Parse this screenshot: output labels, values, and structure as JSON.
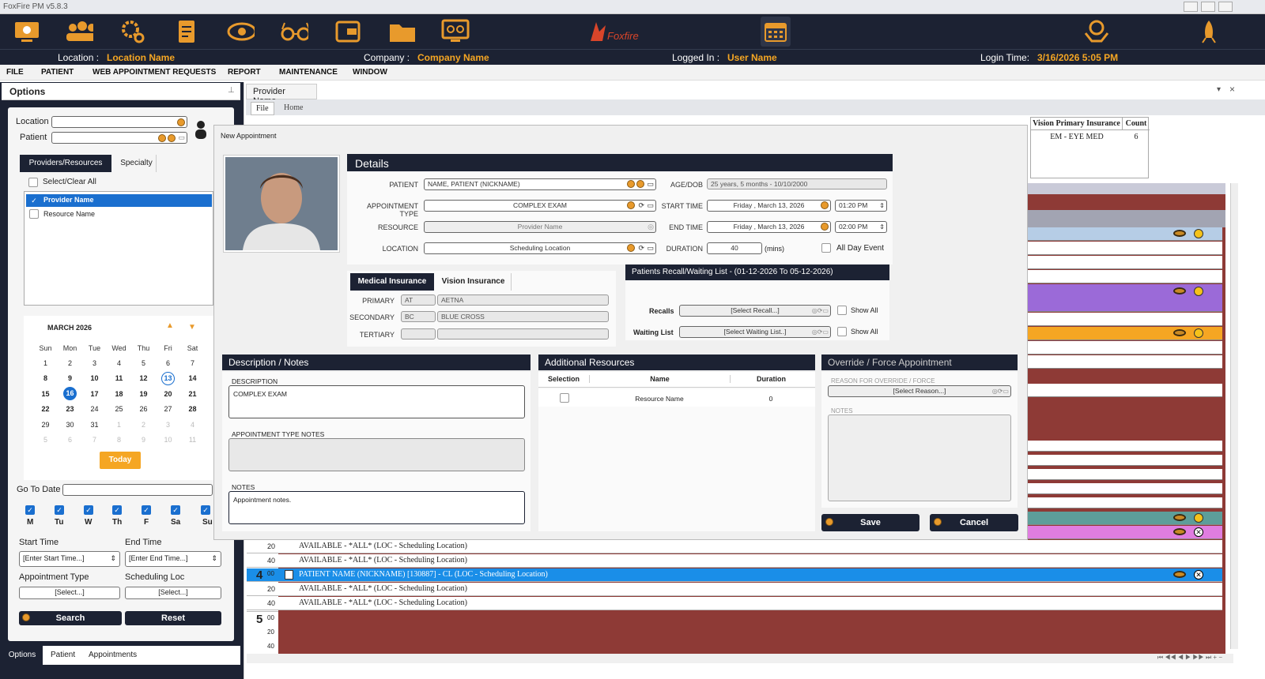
{
  "window": {
    "title": "FoxFire PM v5.8.3"
  },
  "toolbar": {
    "logo_text": "Foxfire"
  },
  "info": {
    "location_label": "Location :",
    "location_value": "Location Name",
    "company_label": "Company :",
    "company_value": "Company Name",
    "logged_label": "Logged In :",
    "logged_value": "User Name",
    "login_label": "Login Time:",
    "login_value": "3/16/2026 5:05 PM"
  },
  "menu": [
    "FILE",
    "PATIENT",
    "WEB APPOINTMENT REQUESTS",
    "REPORT",
    "MAINTENANCE",
    "WINDOW"
  ],
  "options": {
    "title": "Options",
    "location_label": "Location",
    "patient_label": "Patient",
    "tabs": [
      "Providers/Resources",
      "Specialty"
    ],
    "select_all": "Select/Clear All",
    "resources": [
      "Provider Name",
      "Resource Name"
    ],
    "calendar": {
      "month": "MARCH 2026",
      "days": [
        "Sun",
        "Mon",
        "Tue",
        "Wed",
        "Thu",
        "Fri",
        "Sat"
      ],
      "weeks": [
        [
          "1",
          "2",
          "3",
          "4",
          "5",
          "6",
          "7"
        ],
        [
          "8",
          "9",
          "10",
          "11",
          "12",
          "13",
          "14"
        ],
        [
          "15",
          "16",
          "17",
          "18",
          "19",
          "20",
          "21"
        ],
        [
          "22",
          "23",
          "24",
          "25",
          "26",
          "27",
          "28"
        ],
        [
          "29",
          "30",
          "31",
          "1",
          "2",
          "3",
          "4"
        ],
        [
          "5",
          "6",
          "7",
          "8",
          "9",
          "10",
          "11"
        ]
      ]
    },
    "today_button": "Today",
    "goto_label": "Go To Date",
    "weekdays": [
      "M",
      "Tu",
      "W",
      "Th",
      "F",
      "Sa",
      "Su"
    ],
    "start_label": "Start Time",
    "end_label": "End Time",
    "start_placeholder": "[Enter Start Time...]",
    "end_placeholder": "[Enter End Time...]",
    "appt_type_label": "Appointment Type",
    "sched_loc_label": "Scheduling Loc",
    "select_text": "[Select...]",
    "search_button": "Search",
    "reset_button": "Reset",
    "bottom_tabs": [
      "Options",
      "Patient",
      "Appointments"
    ]
  },
  "main": {
    "tab": "Provider Name",
    "subtabs": [
      "File",
      "Home"
    ],
    "header_cols": [
      "Vision Primary Insurance",
      "Count"
    ],
    "header_values": [
      "EM - EYE MED",
      "6"
    ],
    "rows": [
      {
        "text": "AVAILABLE - *ALL* (LOC - Scheduling Location)",
        "min": "20"
      },
      {
        "text": "AVAILABLE - *ALL* (LOC - Scheduling Location)",
        "min": "40"
      },
      {
        "text": "PATIENT NAME (NICKNAME) [130887] - CL (LOC - Scheduling Location)",
        "hour": "4",
        "min": "00"
      },
      {
        "text": "AVAILABLE - *ALL* (LOC - Scheduling Location)",
        "min": "20"
      },
      {
        "text": "AVAILABLE - *ALL* (LOC - Scheduling Location)",
        "min": "40"
      }
    ],
    "hour5": "5",
    "min5": [
      "00",
      "20",
      "40"
    ]
  },
  "modal": {
    "title": "New Appointment",
    "details_title": "Details",
    "patient_label": "PATIENT",
    "patient_value": "NAME, PATIENT  (NICKNAME)",
    "age_label": "AGE/DOB",
    "age_value": "25 years, 5 months - 10/10/2000",
    "appt_type_label": "APPOINTMENT TYPE",
    "appt_type_value": "COMPLEX EXAM",
    "start_label": "START TIME",
    "start_date": "Friday ,  March  13,  2026",
    "start_time": "01:20 PM",
    "resource_label": "RESOURCE",
    "resource_value": "Provider Name",
    "end_label": "END TIME",
    "end_date": "Friday ,  March  13,  2026",
    "end_time": "02:00 PM",
    "location_label": "LOCATION",
    "location_value": "Scheduling Location",
    "duration_label": "DURATION",
    "duration_value": "40",
    "duration_unit": "(mins)",
    "all_day": "All Day Event",
    "ins_tabs": [
      "Medical Insurance",
      "Vision Insurance"
    ],
    "primary_label": "PRIMARY",
    "primary_code": "AT",
    "primary_name": "AETNA",
    "secondary_label": "SECONDARY",
    "secondary_code": "BC",
    "secondary_name": "BLUE CROSS",
    "tertiary_label": "TERTIARY",
    "recall_title": "Patients Recall/Waiting List - (01-12-2026 To 05-12-2026)",
    "recalls_label": "Recalls",
    "recalls_value": "[Select Recall...]",
    "waiting_label": "Waiting List",
    "waiting_value": "[Select Waiting List..]",
    "show_all": "Show All",
    "desc_title": "Description / Notes",
    "desc_label": "DESCRIPTION",
    "desc_value": "COMPLEX EXAM",
    "appt_notes_label": "APPOINTMENT TYPE NOTES",
    "notes_label": "NOTES",
    "notes_value": "Appointment notes.",
    "addl_title": "Additional Resources",
    "addl_cols": [
      "Selection",
      "Name",
      "Duration"
    ],
    "addl_row": {
      "name": "Resource Name",
      "duration": "0"
    },
    "override_title": "Override / Force Appointment",
    "reason_label": "REASON FOR OVERRIDE / FORCE",
    "reason_value": "[Select Reason...]",
    "override_notes_label": "NOTES",
    "save_button": "Save",
    "cancel_button": "Cancel"
  }
}
